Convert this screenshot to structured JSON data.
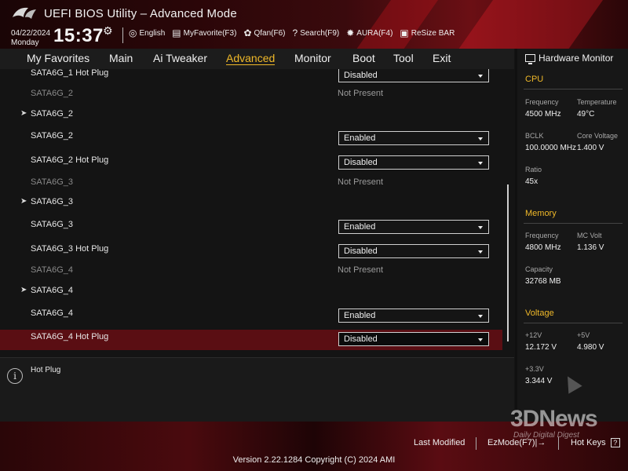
{
  "header": {
    "title": "UEFI BIOS Utility – Advanced Mode",
    "date": "04/22/2024",
    "day": "Monday",
    "time": "15:37",
    "toolbar": [
      {
        "icon": "globe-icon",
        "glyph": "◎",
        "label": "English"
      },
      {
        "icon": "favorite-icon",
        "glyph": "▤",
        "label": "MyFavorite(F3)"
      },
      {
        "icon": "fan-icon",
        "glyph": "✿",
        "label": "Qfan(F6)"
      },
      {
        "icon": "search-icon",
        "glyph": "?",
        "label": "Search(F9)"
      },
      {
        "icon": "aura-icon",
        "glyph": "✹",
        "label": "AURA(F4)"
      },
      {
        "icon": "resize-bar-icon",
        "glyph": "▣",
        "label": "ReSize BAR"
      }
    ]
  },
  "menu": {
    "items": [
      "My Favorites",
      "Main",
      "Ai Tweaker",
      "Advanced",
      "Monitor",
      "Boot",
      "Tool",
      "Exit"
    ],
    "active": "Advanced"
  },
  "rows": [
    {
      "type": "dropdown",
      "label": "SATA6G_1 Hot Plug",
      "value": "Disabled"
    },
    {
      "type": "status",
      "label": "SATA6G_2",
      "value": "Not Present"
    },
    {
      "type": "submenu",
      "label": "SATA6G_2"
    },
    {
      "type": "dropdown",
      "label": "SATA6G_2",
      "value": "Enabled"
    },
    {
      "type": "dropdown",
      "label": "SATA6G_2 Hot Plug",
      "value": "Disabled"
    },
    {
      "type": "status",
      "label": "SATA6G_3",
      "value": "Not Present"
    },
    {
      "type": "submenu",
      "label": "SATA6G_3"
    },
    {
      "type": "dropdown",
      "label": "SATA6G_3",
      "value": "Enabled"
    },
    {
      "type": "dropdown",
      "label": "SATA6G_3 Hot Plug",
      "value": "Disabled"
    },
    {
      "type": "status",
      "label": "SATA6G_4",
      "value": "Not Present"
    },
    {
      "type": "submenu",
      "label": "SATA6G_4"
    },
    {
      "type": "dropdown",
      "label": "SATA6G_4",
      "value": "Enabled"
    },
    {
      "type": "dropdown",
      "label": "SATA6G_4 Hot Plug",
      "value": "Disabled",
      "selected": true
    }
  ],
  "help": {
    "text": "Hot Plug"
  },
  "hardware_monitor": {
    "title": "Hardware Monitor",
    "cpu": {
      "section": "CPU",
      "frequency_label": "Frequency",
      "frequency": "4500 MHz",
      "temperature_label": "Temperature",
      "temperature": "49°C",
      "bclk_label": "BCLK",
      "bclk": "100.0000 MHz",
      "core_voltage_label": "Core Voltage",
      "core_voltage": "1.400 V",
      "ratio_label": "Ratio",
      "ratio": "45x"
    },
    "memory": {
      "section": "Memory",
      "frequency_label": "Frequency",
      "frequency": "4800 MHz",
      "mc_volt_label": "MC Volt",
      "mc_volt": "1.136 V",
      "capacity_label": "Capacity",
      "capacity": "32768 MB"
    },
    "voltage": {
      "section": "Voltage",
      "v12_label": "+12V",
      "v12": "12.172 V",
      "v5_label": "+5V",
      "v5": "4.980 V",
      "v33_label": "+3.3V",
      "v33": "3.344 V"
    }
  },
  "footer": {
    "last_modified": "Last Modified",
    "ezmode": "EzMode(F7)|→",
    "hot_keys": "Hot Keys",
    "hot_keys_icon": "?",
    "version": "Version 2.22.1284 Copyright (C) 2024 AMI"
  },
  "watermark": {
    "brand": "3DNews",
    "tagline": "Daily Digital Digest"
  },
  "colors": {
    "accent": "#f0b929",
    "selected_row": "#5a0e13",
    "header_red": "#6b0f14"
  }
}
